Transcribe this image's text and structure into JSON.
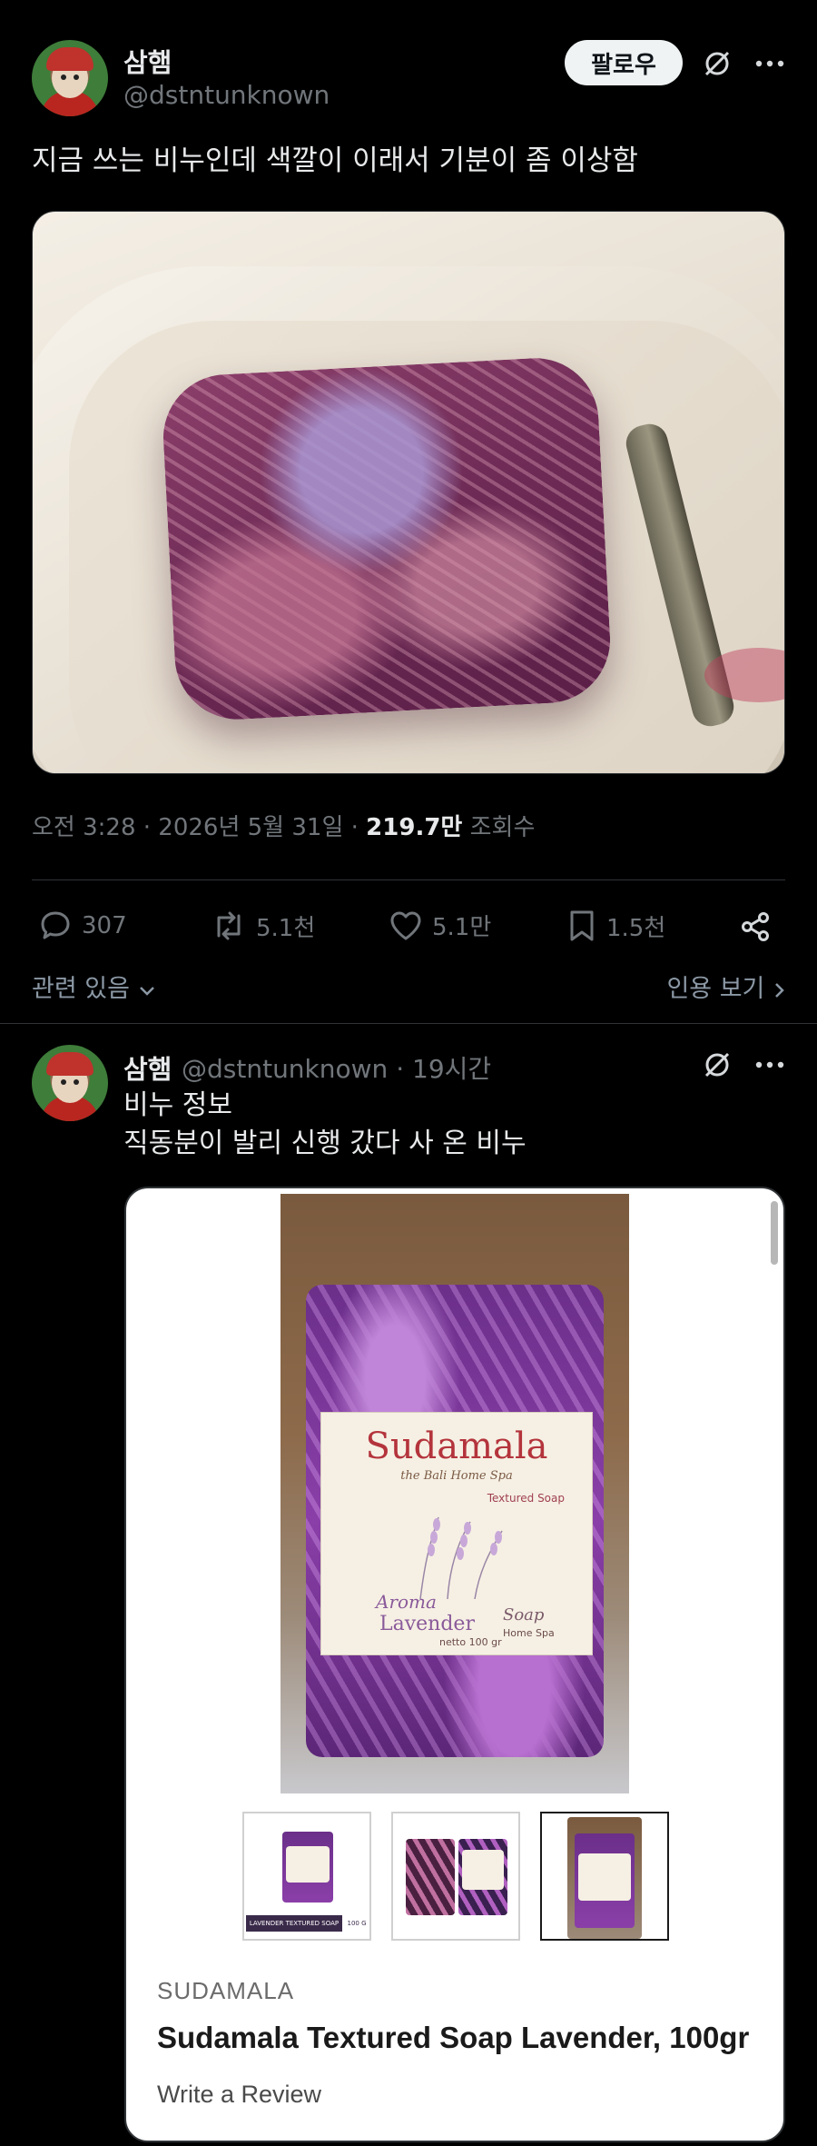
{
  "tweet": {
    "author_name": "삼햄",
    "author_handle": "@dstntunknown",
    "follow_label": "팔로우",
    "text": "지금 쓰는 비누인데 색깔이 이래서 기분이 좀 이상함",
    "time": "오전 3:28 · 2026년 5월 31일 · ",
    "views_count": "219.7만",
    "views_label": " 조회수",
    "actions": {
      "replies": "307",
      "retweets": "5.1천",
      "likes": "5.1만",
      "bookmarks": "1.5천"
    },
    "related_label": "관련 있음",
    "quote_label": "인용 보기"
  },
  "reply": {
    "author_name": "삼햄",
    "author_handle": "@dstntunknown",
    "time": "· 19시간",
    "line1": "비누 정보",
    "line2": "직동분이 발리 신행 갔다 사 온 비누",
    "card": {
      "brand": "SUDAMALA",
      "title": "Sudamala Textured Soap Lavender, 100gr",
      "review": "Write a Review",
      "label_brand": "Sudamala",
      "label_sub": "the Bali Home Spa",
      "label_textured": "Textured Soap",
      "label_aroma": "Aroma",
      "label_lavender": "Lavender",
      "label_soap": "Soap",
      "label_netto": "netto 100 gr",
      "label_homespa": "Home Spa",
      "thumb1_caption": "LAVENDER TEXTURED SOAP",
      "thumb1_size": "100 G"
    }
  },
  "colors": {
    "background": "#000000",
    "text_primary": "#e7e9ea",
    "text_secondary": "#71767b",
    "divider": "#2f3336"
  },
  "icons": [
    "grok-icon",
    "more-icon",
    "reply-icon",
    "retweet-icon",
    "like-icon",
    "bookmark-icon",
    "share-icon",
    "chevron-down-icon",
    "chevron-right-icon"
  ]
}
